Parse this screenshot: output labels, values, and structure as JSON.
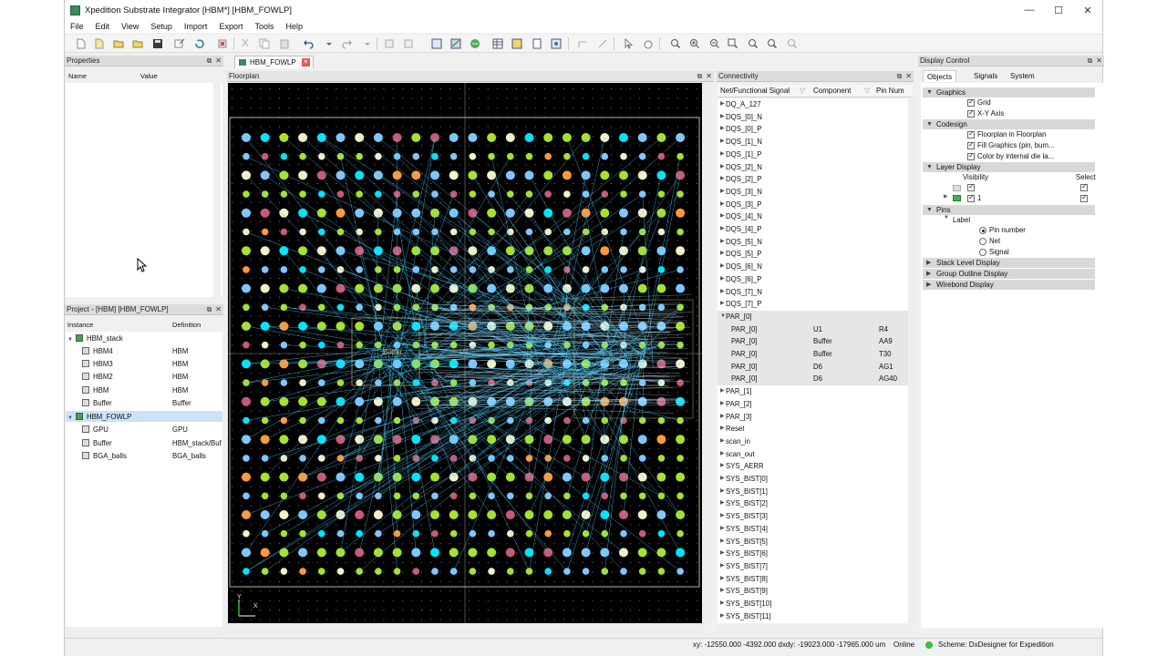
{
  "window": {
    "title": "Xpedition Substrate Integrator [HBM*] [HBM_FOWLP]",
    "controls": [
      "—",
      "☐",
      "✕"
    ]
  },
  "menu": [
    "File",
    "Edit",
    "View",
    "Setup",
    "Import",
    "Export",
    "Tools",
    "Help"
  ],
  "properties": {
    "title": "Properties",
    "col_name": "Name",
    "col_value": "Value"
  },
  "project": {
    "title": "Project - [HBM] [HBM_FOWLP]",
    "col_instance": "Instance",
    "col_definition": "Definition",
    "rows": [
      {
        "name": "HBM_stack",
        "def": ""
      },
      {
        "name": "HBM4",
        "def": "HBM"
      },
      {
        "name": "HBM3",
        "def": "HBM"
      },
      {
        "name": "HBM2",
        "def": "HBM"
      },
      {
        "name": "HBM",
        "def": "HBM"
      },
      {
        "name": "Buffer",
        "def": "Buffer"
      },
      {
        "name": "HBM_FOWLP",
        "def": ""
      },
      {
        "name": "GPU",
        "def": "GPU"
      },
      {
        "name": "Buffer",
        "def": "HBM_stack/Buf"
      },
      {
        "name": "BGA_balls",
        "def": "BGA_balls"
      }
    ]
  },
  "doc_tab": "HBM_FOWLP",
  "floorplan": {
    "title": "Floorplan",
    "labels": [
      "Buffer",
      "U1",
      "D6"
    ],
    "axis_x": "X",
    "axis_y": "Y"
  },
  "connectivity": {
    "title": "Connectivity",
    "col_signal": "Net/Functional Signal",
    "col_component": "Component",
    "col_pin": "Pin Num",
    "rows_top": [
      "DQ_A_127",
      "DQS_[0]_N",
      "DQS_[0]_P",
      "DQS_[1]_N",
      "DQS_[1]_P",
      "DQS_[2]_N",
      "DQS_[2]_P",
      "DQS_[3]_N",
      "DQS_[3]_P",
      "DQS_[4]_N",
      "DQS_[4]_P",
      "DQS_[5]_N",
      "DQS_[5]_P",
      "DQS_[6]_N",
      "DQS_[6]_P",
      "DQS_[7]_N",
      "DQS_[7]_P"
    ],
    "expanded": "PAR_[0]",
    "sub_rows": [
      {
        "net": "PAR_[0]",
        "comp": "U1",
        "pin": "R4"
      },
      {
        "net": "PAR_[0]",
        "comp": "Buffer",
        "pin": "AA9"
      },
      {
        "net": "PAR_[0]",
        "comp": "Buffer",
        "pin": "T30"
      },
      {
        "net": "PAR_[0]",
        "comp": "D6",
        "pin": "AG1"
      },
      {
        "net": "PAR_[0]",
        "comp": "D6",
        "pin": "AG40"
      }
    ],
    "rows_bottom": [
      "PAR_[1]",
      "PAR_[2]",
      "PAR_[3]",
      "Reset",
      "scan_in",
      "scan_out",
      "SYS_AERR",
      "SYS_BIST[0]",
      "SYS_BIST[1]",
      "SYS_BIST[2]",
      "SYS_BIST[3]",
      "SYS_BIST[4]",
      "SYS_BIST[5]",
      "SYS_BIST[6]",
      "SYS_BIST[7]",
      "SYS_BIST[8]",
      "SYS_BIST[9]",
      "SYS_BIST[10]",
      "SYS_BIST[11]"
    ]
  },
  "display_control": {
    "title": "Display Control",
    "tabs": [
      "Objects",
      "Signals",
      "System"
    ],
    "graphics": {
      "title": "Graphics",
      "items": [
        "Grid",
        "X-Y Axis"
      ]
    },
    "codesign": {
      "title": "Codesign",
      "items": [
        "Floorplan in Floorplan",
        "Fill Graphics (pin, bum...",
        "Color by internal die la..."
      ]
    },
    "layer": {
      "title": "Layer Display",
      "visibility": "Visibility",
      "select": "Select",
      "layer_name": "1"
    },
    "pins": {
      "title": "Pins",
      "label": "Label",
      "options": [
        "Pin number",
        "Net",
        "Signal"
      ]
    },
    "collapsed": [
      "Stack Level Display",
      "Group Outline Display",
      "Wirebond Display"
    ]
  },
  "status": {
    "coords": "xy: -12550.000 -4392.000 dxdy: -19023.000 -17965.000 um",
    "online": "Online",
    "scheme": "Scheme: DxDesigner for Expedition"
  },
  "colors": {
    "green": "#a6e22e",
    "blue": "#7ec8ff",
    "cyan": "#00e5ff",
    "pink": "#c85a78",
    "orange": "#ff9a3c",
    "light": "#f4f0c8"
  }
}
